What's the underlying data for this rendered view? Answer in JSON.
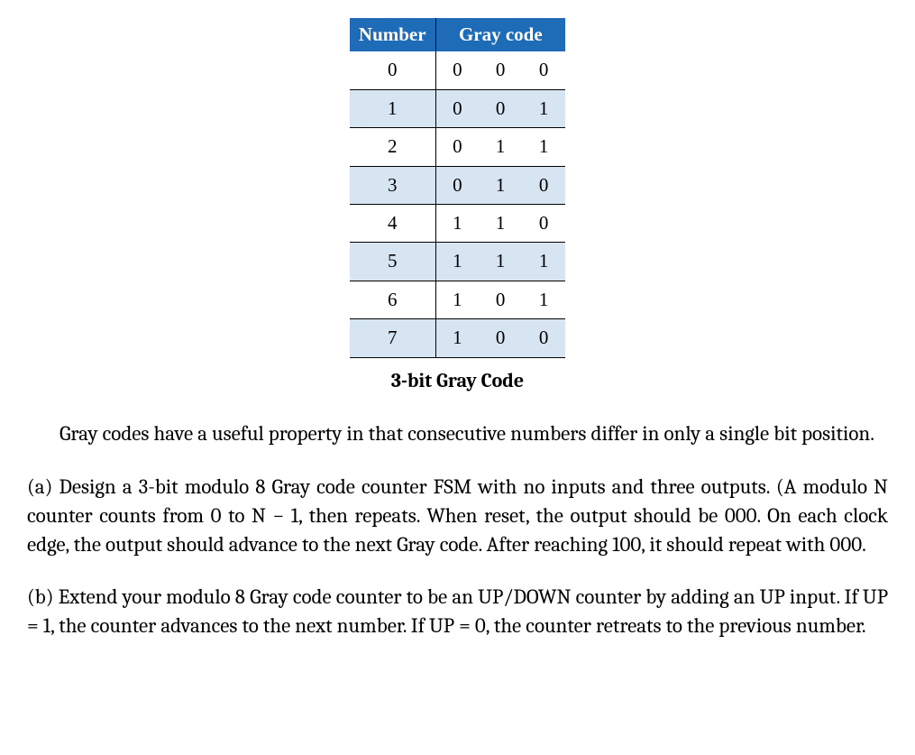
{
  "table": {
    "headers": {
      "number": "Number",
      "gray": "Gray code"
    },
    "rows": [
      {
        "num": "0",
        "b2": "0",
        "b1": "0",
        "b0": "0"
      },
      {
        "num": "1",
        "b2": "0",
        "b1": "0",
        "b0": "1"
      },
      {
        "num": "2",
        "b2": "0",
        "b1": "1",
        "b0": "1"
      },
      {
        "num": "3",
        "b2": "0",
        "b1": "1",
        "b0": "0"
      },
      {
        "num": "4",
        "b2": "1",
        "b1": "1",
        "b0": "0"
      },
      {
        "num": "5",
        "b2": "1",
        "b1": "1",
        "b0": "1"
      },
      {
        "num": "6",
        "b2": "1",
        "b1": "0",
        "b0": "1"
      },
      {
        "num": "7",
        "b2": "1",
        "b1": "0",
        "b0": "0"
      }
    ],
    "caption": "3-bit Gray Code"
  },
  "paragraphs": {
    "intro": "Gray codes have a useful property in that consecutive numbers differ in only a single bit position.",
    "part_a": "(a) Design a 3-bit modulo 8 Gray code counter FSM with no inputs and three outputs. (A modulo N counter counts from 0 to N − 1, then repeats. When reset, the output should be 000. On each clock edge, the output should advance to the next Gray code. After reaching 100, it should repeat with 000.",
    "part_b": "(b) Extend your modulo 8 Gray code counter to be an UP/DOWN counter by adding an UP input. If UP = 1, the counter advances to the next number. If UP = 0, the counter retreats to the previous number."
  },
  "chart_data": {
    "type": "table",
    "title": "3-bit Gray Code",
    "columns": [
      "Number",
      "Gray code bit 2",
      "Gray code bit 1",
      "Gray code bit 0"
    ],
    "rows": [
      [
        0,
        0,
        0,
        0
      ],
      [
        1,
        0,
        0,
        1
      ],
      [
        2,
        0,
        1,
        1
      ],
      [
        3,
        0,
        1,
        0
      ],
      [
        4,
        1,
        1,
        0
      ],
      [
        5,
        1,
        1,
        1
      ],
      [
        6,
        1,
        0,
        1
      ],
      [
        7,
        1,
        0,
        0
      ]
    ]
  }
}
